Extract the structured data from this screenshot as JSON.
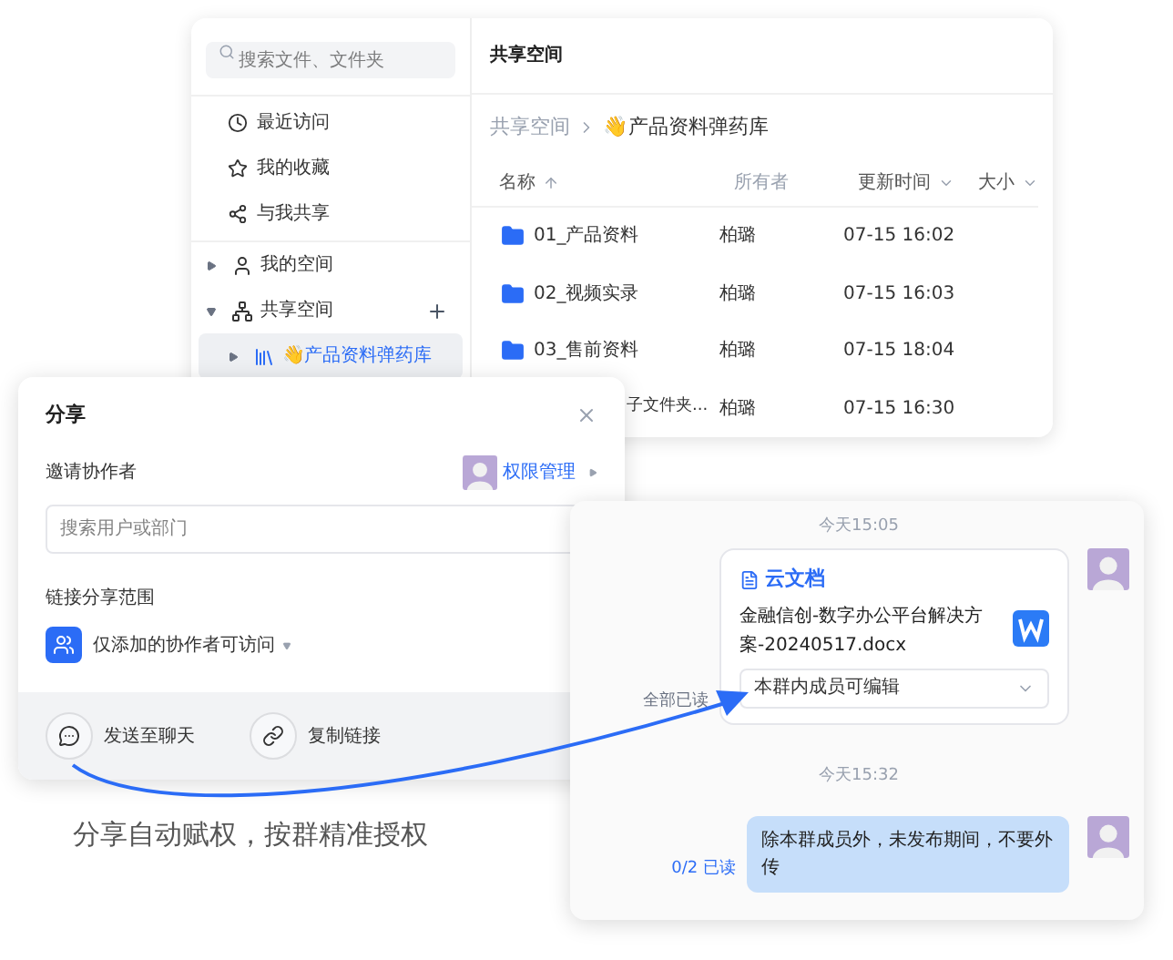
{
  "file_window": {
    "sidebar": {
      "search": {
        "placeholder": "搜索文件、文件夹"
      },
      "quick_links": [
        {
          "label": "最近访问",
          "kind": "recent"
        },
        {
          "label": "我的收藏",
          "kind": "favorite"
        },
        {
          "label": "与我共享",
          "kind": "shared"
        }
      ],
      "tree": [
        {
          "label": "我的空间",
          "kind": "personal",
          "expanded": false,
          "selected": false,
          "add_button": false
        },
        {
          "label": "共享空间",
          "kind": "team",
          "expanded": true,
          "selected": false,
          "add_button": true,
          "children": [
            {
              "label": "👋产品资料弹药库",
              "kind": "library",
              "expanded": false,
              "selected": true,
              "add_button": false
            }
          ]
        }
      ]
    },
    "main": {
      "title": "共享空间",
      "breadcrumb": [
        "共享空间",
        "👋产品资料弹药库"
      ],
      "columns": [
        {
          "label": "名称",
          "sort_arrow": true,
          "dropdown": false
        },
        {
          "label": "所有者",
          "sort_arrow": false,
          "dropdown": false
        },
        {
          "label": "更新时间",
          "sort_arrow": false,
          "dropdown": true
        },
        {
          "label": "大小",
          "sort_arrow": false,
          "dropdown": true
        }
      ],
      "rows": [
        {
          "name": "01_产品资料",
          "owner": "柏璐",
          "updated": "07-15 16:02",
          "covered": false
        },
        {
          "name": "02_视频实录",
          "owner": "柏璐",
          "updated": "07-15 16:03",
          "covered": false
        },
        {
          "name": "03_售前资料",
          "owner": "柏璐",
          "updated": "07-15 18:04",
          "covered": false
        },
        {
          "name": "子文件夹...",
          "owner": "柏璐",
          "updated": "07-15 16:30",
          "covered": true
        }
      ]
    }
  },
  "share_dialog": {
    "title": "分享",
    "invite_label": "邀请协作者",
    "permission_link": "权限管理",
    "search": {
      "placeholder": "搜索用户或部门"
    },
    "scope_label": "链接分享范围",
    "scope_value": "仅添加的协作者可访问",
    "actions": [
      {
        "label": "发送至聊天",
        "kind": "chat"
      },
      {
        "label": "复制链接",
        "kind": "link"
      }
    ]
  },
  "chat": {
    "messages": [
      {
        "kind": "time",
        "text": "今天15:05"
      },
      {
        "kind": "doc_card",
        "header": "云文档",
        "file": "金融信创-数字办公平台解决方案-20240517.docx",
        "permission": "本群内成员可编辑",
        "receipt": "全部已读",
        "all_read": true
      },
      {
        "kind": "time",
        "text": "今天15:32"
      },
      {
        "kind": "text",
        "text": "除本群成员外，未发布期间，不要外传",
        "receipt": "0/2 已读",
        "all_read": false
      }
    ]
  },
  "caption": "分享自动赋权，按群精准授权"
}
